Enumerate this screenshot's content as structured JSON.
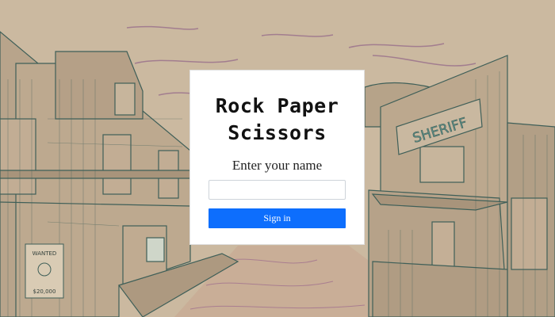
{
  "card": {
    "title_line1": "Rock Paper",
    "title_line2": "Scissors",
    "name_label": "Enter your name",
    "name_value": "",
    "signin_label": "Sign in"
  },
  "scene": {
    "sheriff_sign": "SHERIFF",
    "wanted_text": "WANTED",
    "reward_text": "$20,000"
  },
  "colors": {
    "paper": "#cbb9a0",
    "ink": "#3f5f58",
    "sky_streak": "#8d5e86",
    "button": "#0d6efd"
  }
}
